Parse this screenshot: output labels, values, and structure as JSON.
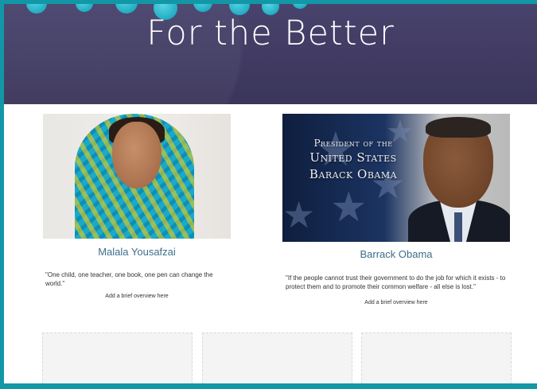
{
  "banner": {
    "title": "For the Better"
  },
  "cards": [
    {
      "name": "Malala Yousafzai",
      "quote": "\"One child, one teacher, one book, one pen can change the world.\"",
      "overview": "Add a brief overview here"
    },
    {
      "name": "Barrack Obama",
      "quote": "\"If the people cannot trust their government to do the job for which it exists - to protect them and to promote their common welfare - all else is lost.\"",
      "overview": "Add a brief overview here",
      "photo_text": {
        "line1": "President of the",
        "line2": "United States",
        "line3": "Barack Obama"
      }
    }
  ],
  "colors": {
    "frame": "#1297a6",
    "banner": "#453f69",
    "name_link": "#3f6d8a"
  }
}
